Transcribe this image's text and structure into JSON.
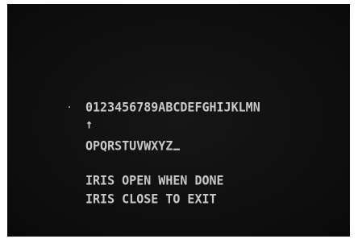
{
  "screen": {
    "charset_row1": "0123456789ABCDEFGHIJKLMN",
    "selector_arrow": "↑",
    "charset_row2": "OPQRSTUVWXYZ",
    "instruction_open": "IRIS OPEN WHEN DONE",
    "instruction_close": "IRIS CLOSE TO EXIT",
    "text_color": "#c8c8c8",
    "background_color": "#111111",
    "cursor_icon": "underscore-cursor-icon"
  }
}
